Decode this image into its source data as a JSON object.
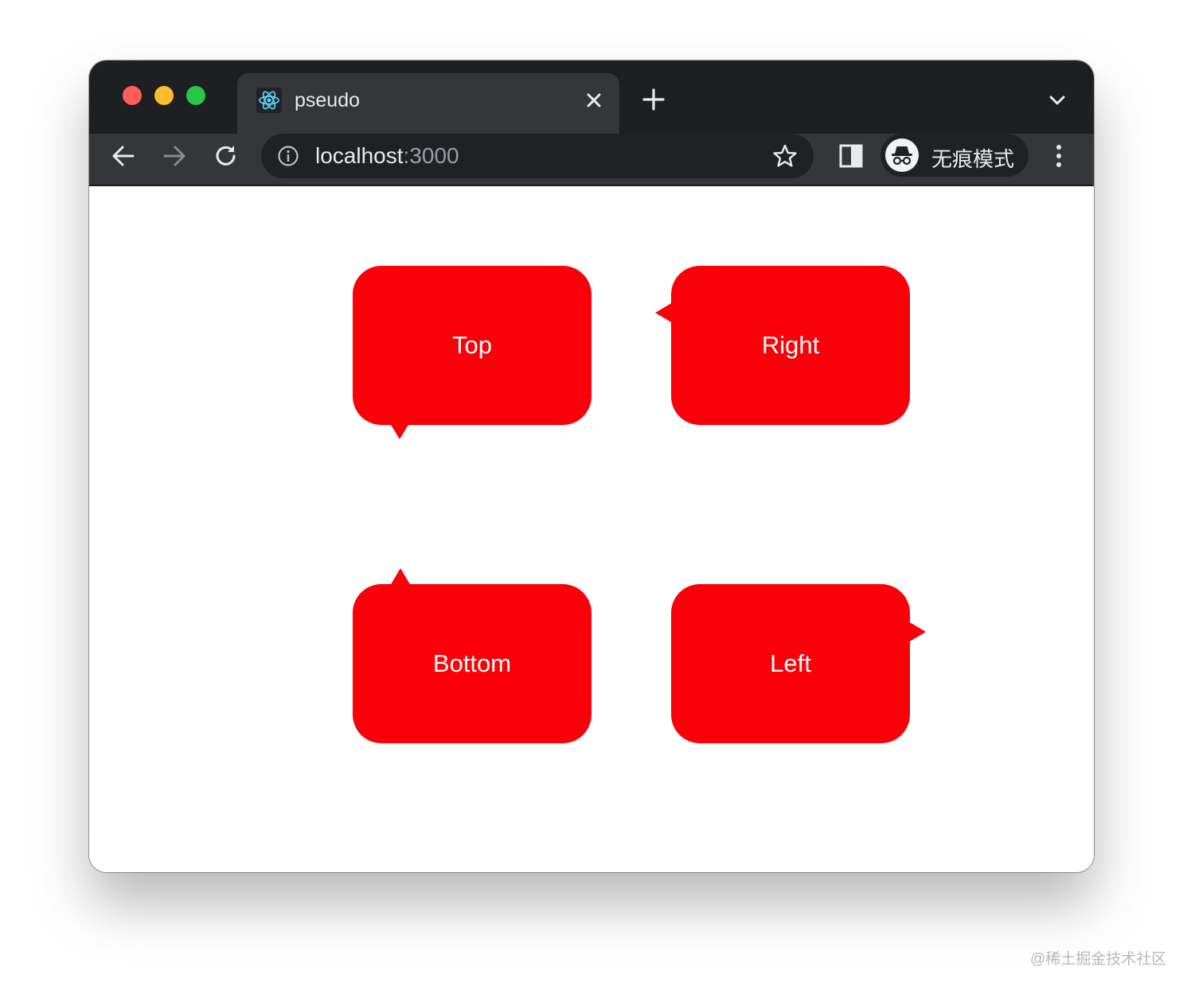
{
  "tab": {
    "title": "pseudo",
    "favicon": "react-icon"
  },
  "address_bar": {
    "host": "localhost",
    "port": ":3000"
  },
  "incognito": {
    "label": "无痕模式",
    "icon": "incognito-icon"
  },
  "bubbles": [
    {
      "label": "Top",
      "pointer": "bottom-left"
    },
    {
      "label": "Right",
      "pointer": "left"
    },
    {
      "label": "Bottom",
      "pointer": "top-left"
    },
    {
      "label": "Left",
      "pointer": "right"
    }
  ],
  "colors": {
    "bubble": "#fa0008",
    "titlebar": "#1e1f22",
    "toolbar": "#35363a",
    "close_dot": "#ff5f57",
    "minimize_dot": "#febc2e",
    "zoom_dot": "#28c840"
  },
  "icons": [
    "back-arrow-icon",
    "forward-arrow-icon",
    "reload-icon",
    "info-icon",
    "star-icon",
    "side-panel-icon",
    "kebab-menu-icon",
    "plus-icon",
    "close-icon",
    "chevron-down-icon"
  ],
  "watermark": "@稀土掘金技术社区"
}
